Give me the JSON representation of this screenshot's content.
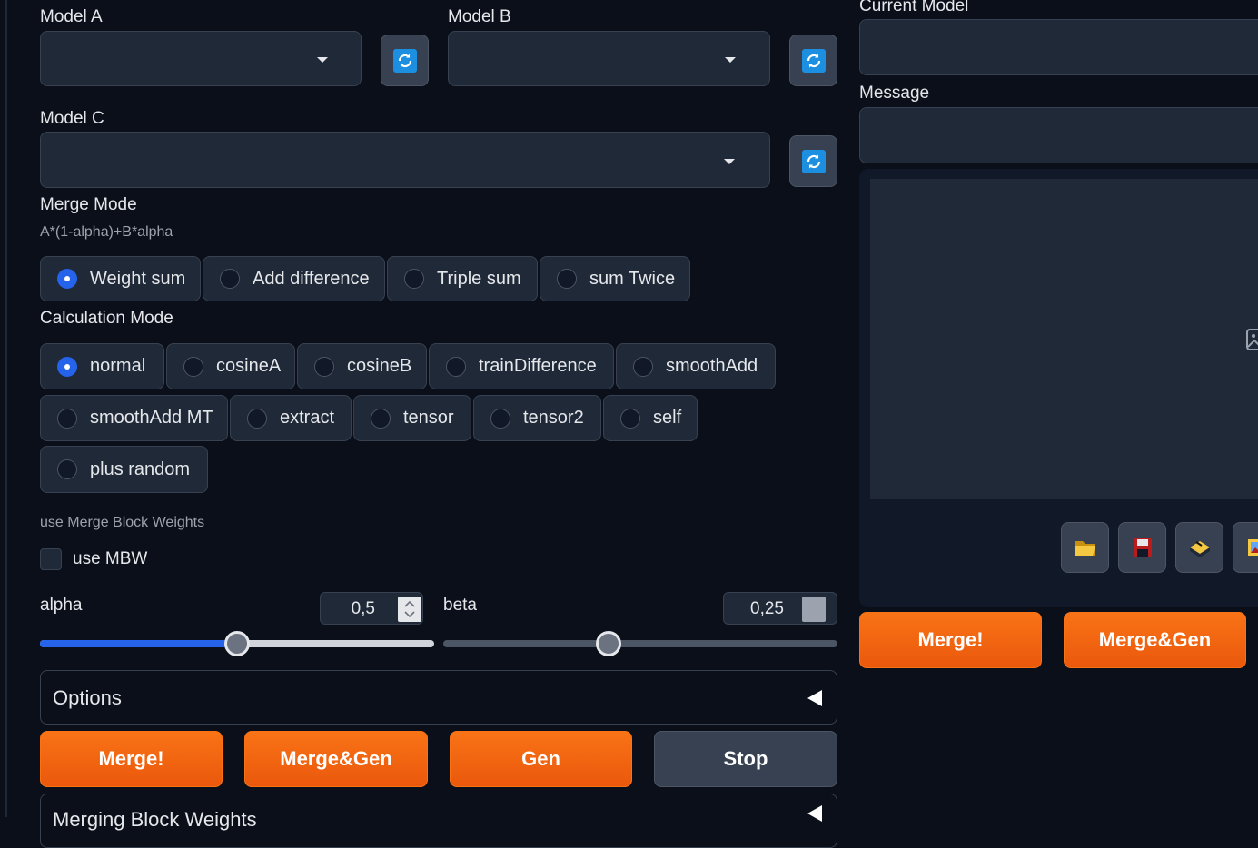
{
  "models": {
    "model_a": {
      "label": "Model A",
      "value": ""
    },
    "model_b": {
      "label": "Model B",
      "value": ""
    },
    "model_c": {
      "label": "Model C",
      "value": ""
    }
  },
  "merge_mode": {
    "label": "Merge Mode",
    "formula": "A*(1-alpha)+B*alpha",
    "options": [
      "Weight sum",
      "Add difference",
      "Triple sum",
      "sum Twice"
    ],
    "selected": "Weight sum"
  },
  "calc_mode": {
    "label": "Calculation Mode",
    "options": [
      "normal",
      "cosineA",
      "cosineB",
      "trainDifference",
      "smoothAdd",
      "smoothAdd MT",
      "extract",
      "tensor",
      "tensor2",
      "self",
      "plus random"
    ],
    "selected": "normal"
  },
  "mbw": {
    "section_label": "use Merge Block Weights",
    "checkbox_label": "use MBW",
    "checked": false
  },
  "alpha": {
    "label": "alpha",
    "value": "0,5",
    "fraction": 0.5
  },
  "beta": {
    "label": "beta",
    "value": "0,25",
    "fraction": 0.42
  },
  "options_accordion": {
    "label": "Options",
    "collapsed": true
  },
  "actions": {
    "merge": "Merge!",
    "merge_gen": "Merge&Gen",
    "gen": "Gen",
    "stop": "Stop"
  },
  "next_accordion": {
    "label": "Merging Block Weights"
  },
  "right": {
    "current_model_label": "Current Model",
    "current_model_value": "",
    "message_label": "Message",
    "message_value": "",
    "tools": [
      "folder-icon",
      "save-icon",
      "archive-icon",
      "image-icon"
    ],
    "merge": "Merge!",
    "merge_gen": "Merge&Gen"
  },
  "colors": {
    "accent_orange": "#f97316",
    "accent_blue": "#2563eb",
    "background": "#0b0f19",
    "surface": "#1f2937"
  }
}
